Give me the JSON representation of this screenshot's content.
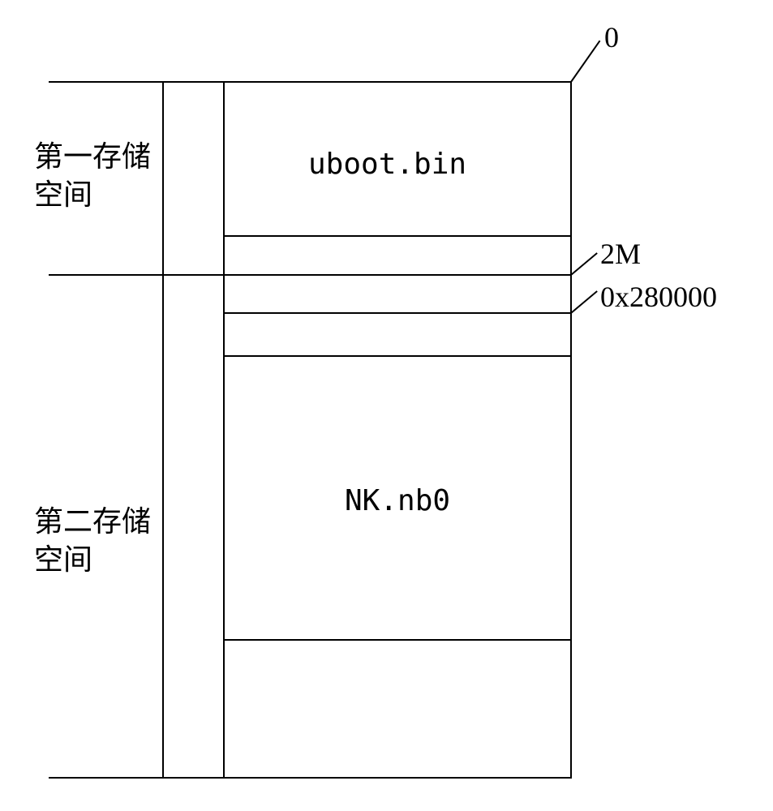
{
  "labels": {
    "first_storage": "第一存储\n空间",
    "second_storage": "第二存储\n空间"
  },
  "blocks": {
    "uboot": "uboot.bin",
    "nk": "NK.nb0"
  },
  "addresses": {
    "addr0": "0",
    "addr2m": "2M",
    "addr280000": "0x280000"
  }
}
